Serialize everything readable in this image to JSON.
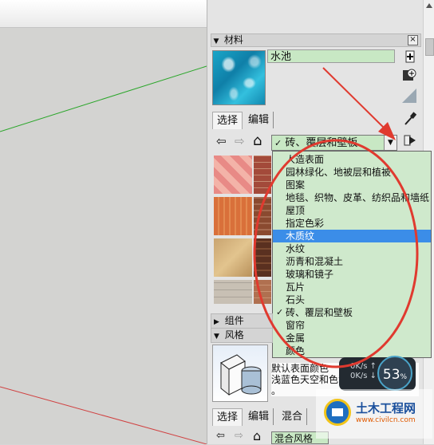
{
  "materials_panel": {
    "title": "材料",
    "close_label": "×",
    "material_name": "水池",
    "tabs": [
      "选择",
      "编辑"
    ],
    "category_selected": "砖、覆层和壁板",
    "category_options": [
      {
        "label": "人造表面",
        "checked": false,
        "highlighted": false
      },
      {
        "label": "园林绿化、地被层和植被",
        "checked": false,
        "highlighted": false
      },
      {
        "label": "图案",
        "checked": false,
        "highlighted": false
      },
      {
        "label": "地毯、织物、皮革、纺织品和墙纸",
        "checked": false,
        "highlighted": false
      },
      {
        "label": "屋顶",
        "checked": false,
        "highlighted": false
      },
      {
        "label": "指定色彩",
        "checked": false,
        "highlighted": false
      },
      {
        "label": "木质纹",
        "checked": false,
        "highlighted": true
      },
      {
        "label": "水纹",
        "checked": false,
        "highlighted": false
      },
      {
        "label": "沥青和混凝土",
        "checked": false,
        "highlighted": false
      },
      {
        "label": "玻璃和镜子",
        "checked": false,
        "highlighted": false
      },
      {
        "label": "瓦片",
        "checked": false,
        "highlighted": false
      },
      {
        "label": "石头",
        "checked": false,
        "highlighted": false
      },
      {
        "label": "砖、覆层和壁板",
        "checked": true,
        "highlighted": false
      },
      {
        "label": "窗帘",
        "checked": false,
        "highlighted": false
      },
      {
        "label": "金属",
        "checked": false,
        "highlighted": false
      },
      {
        "label": "颜色",
        "checked": false,
        "highlighted": false
      }
    ]
  },
  "components_panel": {
    "title": "组件"
  },
  "styles_panel": {
    "title": "风格",
    "description_line1": "默认表面颜色",
    "description_line2": "浅蓝色天空和色背景",
    "description_line3": "。",
    "tabs": [
      "选择",
      "编辑",
      "混合"
    ],
    "select_value": "混合风格"
  },
  "perf_widget": {
    "up": "0K/s",
    "down": "0K/s",
    "percent": "53",
    "unit": "%"
  },
  "watermark": {
    "title": "土木工程网",
    "url": "www.civilcn.com"
  },
  "icons": {
    "check": "✓",
    "dropdown": "▼",
    "collapse": "▼",
    "expand": "▶",
    "back": "⇦",
    "forward": "⇨",
    "home": "⌂"
  },
  "colors": {
    "annotation": "#e03a2f",
    "highlight": "#3b8de8",
    "field_green": "#c8e8c4"
  }
}
